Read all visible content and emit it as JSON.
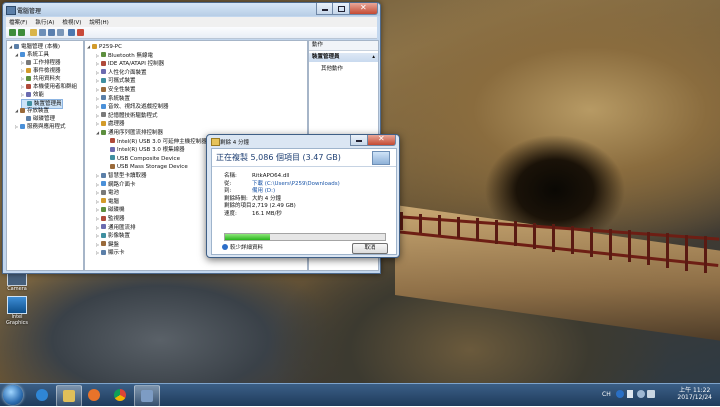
{
  "window": {
    "title": "電腦管理",
    "menu": [
      "檔案(F)",
      "執行(A)",
      "檢視(V)",
      "說明(H)"
    ],
    "tree": [
      {
        "label": "電腦管理 (本機)",
        "indent": 0,
        "expander": "◢"
      },
      {
        "label": "系統工具",
        "indent": 1,
        "expander": "◢"
      },
      {
        "label": "工作排程器",
        "indent": 2,
        "expander": "▷"
      },
      {
        "label": "事件檢視器",
        "indent": 2,
        "expander": "▷"
      },
      {
        "label": "共用資料夾",
        "indent": 2,
        "expander": "▷"
      },
      {
        "label": "本機使用者和群組",
        "indent": 2,
        "expander": "▷"
      },
      {
        "label": "效能",
        "indent": 2,
        "expander": "▷"
      },
      {
        "label": "裝置管理員",
        "indent": 2,
        "expander": "",
        "selected": true
      },
      {
        "label": "存放裝置",
        "indent": 1,
        "expander": "◢"
      },
      {
        "label": "磁碟管理",
        "indent": 2,
        "expander": ""
      },
      {
        "label": "服務與應用程式",
        "indent": 1,
        "expander": "▷"
      }
    ],
    "devices": [
      {
        "label": "P259-PC",
        "indent": 0,
        "expander": "◢"
      },
      {
        "label": "Bluetooth 無線電",
        "indent": 1,
        "expander": "▷"
      },
      {
        "label": "IDE ATA/ATAPI 控制器",
        "indent": 1,
        "expander": "▷"
      },
      {
        "label": "人性化介面裝置",
        "indent": 1,
        "expander": "▷"
      },
      {
        "label": "可攜式裝置",
        "indent": 1,
        "expander": "▷"
      },
      {
        "label": "安全性裝置",
        "indent": 1,
        "expander": "▷"
      },
      {
        "label": "系統裝置",
        "indent": 1,
        "expander": "▷"
      },
      {
        "label": "音效、視訊及遊戲控制器",
        "indent": 1,
        "expander": "▷"
      },
      {
        "label": "記憶體技術驅動程式",
        "indent": 1,
        "expander": "▷"
      },
      {
        "label": "處理器",
        "indent": 1,
        "expander": "▷"
      },
      {
        "label": "通用序列匯流排控制器",
        "indent": 1,
        "expander": "◢"
      },
      {
        "label": "Intel(R) USB 3.0 可延伸主機控制器",
        "indent": 2,
        "expander": ""
      },
      {
        "label": "Intel(R) USB 3.0 根集線器",
        "indent": 2,
        "expander": ""
      },
      {
        "label": "USB Composite Device",
        "indent": 2,
        "expander": ""
      },
      {
        "label": "USB Mass Storage Device",
        "indent": 2,
        "expander": ""
      },
      {
        "label": "智慧型卡讀取器",
        "indent": 1,
        "expander": "▷"
      },
      {
        "label": "網路介面卡",
        "indent": 1,
        "expander": "▷"
      },
      {
        "label": "電池",
        "indent": 1,
        "expander": "▷"
      },
      {
        "label": "電腦",
        "indent": 1,
        "expander": "▷"
      },
      {
        "label": "磁碟機",
        "indent": 1,
        "expander": "▷"
      },
      {
        "label": "監視器",
        "indent": 1,
        "expander": "▷"
      },
      {
        "label": "通用匯流排",
        "indent": 1,
        "expander": "▷"
      },
      {
        "label": "影像裝置",
        "indent": 1,
        "expander": "▷"
      },
      {
        "label": "鍵盤",
        "indent": 1,
        "expander": "▷"
      },
      {
        "label": "顯示卡",
        "indent": 1,
        "expander": "▷"
      }
    ],
    "actions": {
      "header": "動作",
      "section": "裝置管理員",
      "more": "其他動作"
    }
  },
  "copy_dialog": {
    "title": "剩餘 4 分鐘",
    "caption": "正在複製 5,086 個項目 (3.47 GB)",
    "fields": [
      {
        "k": "名稱:",
        "v": "RitkAPO64.dll"
      },
      {
        "k": "從:",
        "v": "下載 (C:\\Users\\P259\\Downloads)"
      },
      {
        "k": "到:",
        "v": "備用 (D:)"
      },
      {
        "k": "剩餘時間:",
        "v": "大約 4 分鐘"
      },
      {
        "k": "剩餘的項目:",
        "v": "2,719 (2.49 GB)"
      },
      {
        "k": "速度:",
        "v": "16.1 MB/秒"
      }
    ],
    "progress": 0.28,
    "less_info": "較少詳細資料",
    "cancel": "取消"
  },
  "desktop": {
    "icons": [
      "Camera",
      "Intel Graphics"
    ]
  },
  "tray": {
    "lang": "CH",
    "time": "上午 11:22",
    "date": "2017/12/24"
  }
}
